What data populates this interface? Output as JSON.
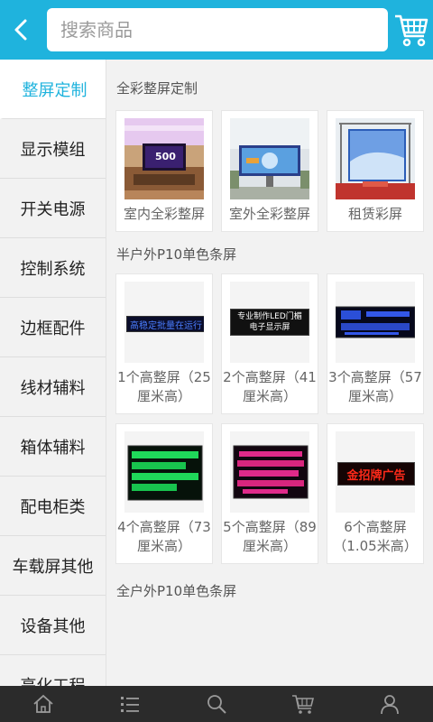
{
  "search": {
    "placeholder": "搜索商品"
  },
  "sidebar": {
    "items": [
      {
        "label": "整屏定制",
        "active": true
      },
      {
        "label": "显示模组",
        "active": false
      },
      {
        "label": "开关电源",
        "active": false
      },
      {
        "label": "控制系统",
        "active": false
      },
      {
        "label": "边框配件",
        "active": false
      },
      {
        "label": "线材辅料",
        "active": false
      },
      {
        "label": "箱体辅料",
        "active": false
      },
      {
        "label": "配电柜类",
        "active": false
      },
      {
        "label": "车载屏其他",
        "active": false
      },
      {
        "label": "设备其他",
        "active": false
      },
      {
        "label": "亮化工程",
        "active": false
      }
    ]
  },
  "sections": [
    {
      "title": "全彩整屏定制",
      "products": [
        {
          "label": "室内全彩整屏"
        },
        {
          "label": "室外全彩整屏"
        },
        {
          "label": "租赁彩屏"
        }
      ]
    },
    {
      "title": "半户外P10单色条屏",
      "products": [
        {
          "label": "1个高整屏（25厘米高）",
          "sign_text": "高稳定批量在运行"
        },
        {
          "label": "2个高整屏（41厘米高）",
          "sign_text": "专业制作LED门楣 电子显示屏"
        },
        {
          "label": "3个高整屏（57厘米高）"
        },
        {
          "label": "4个高整屏（73厘米高）"
        },
        {
          "label": "5个高整屏（89厘米高）"
        },
        {
          "label": "6个高整屏（1.05米高）",
          "sign_text": "金招牌广告"
        }
      ]
    },
    {
      "title": "全户外P10单色条屏"
    }
  ],
  "bottom_nav": [
    {
      "icon": "home-icon"
    },
    {
      "icon": "list-icon"
    },
    {
      "icon": "search-icon"
    },
    {
      "icon": "cart-icon"
    },
    {
      "icon": "user-icon"
    }
  ],
  "colors": {
    "accent": "#1fb3dd",
    "nav_bg": "#2b2b2b"
  }
}
